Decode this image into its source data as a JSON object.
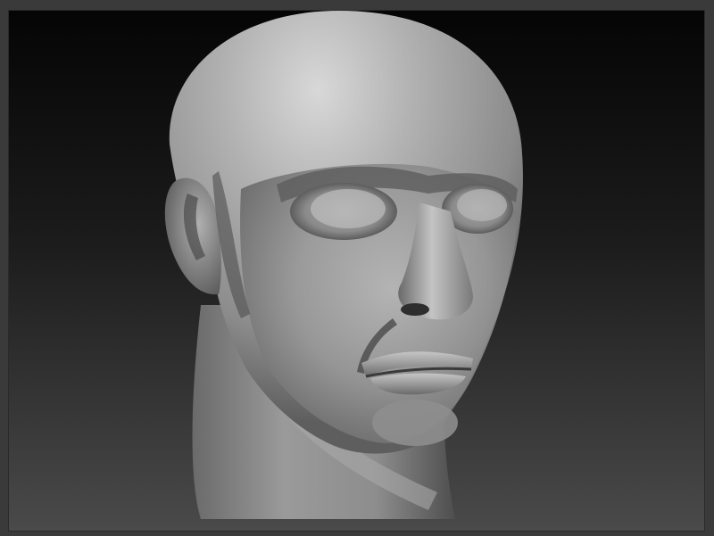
{
  "app": {
    "document_background": "#3a3a3a",
    "viewport_gradient_top": "#050505",
    "viewport_gradient_bottom": "#4a4a4a"
  },
  "viewport": {
    "model": "sculpted-head-bust",
    "material_color": "#9a9a9a"
  }
}
